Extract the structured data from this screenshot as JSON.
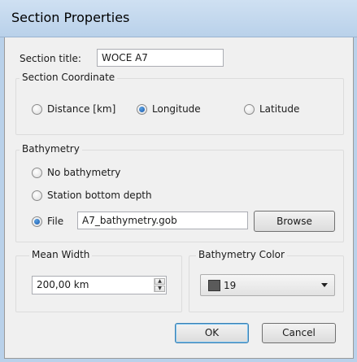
{
  "window": {
    "title": "Section Properties"
  },
  "section_title": {
    "label": "Section title:",
    "value": "WOCE A7"
  },
  "coordinate": {
    "group_label": "Section Coordinate",
    "options": [
      "Distance [km]",
      "Longitude",
      "Latitude"
    ],
    "selected": "Longitude"
  },
  "bathymetry": {
    "group_label": "Bathymetry",
    "options": [
      "No bathymetry",
      "Station bottom depth",
      "File"
    ],
    "selected": "File",
    "file_value": "A7_bathymetry.gob",
    "browse_label": "Browse"
  },
  "mean_width": {
    "group_label": "Mean Width",
    "value": "200,00 km"
  },
  "bathymetry_color": {
    "group_label": "Bathymetry Color",
    "value": "19",
    "swatch_color": "#5a5a5a"
  },
  "buttons": {
    "ok_label": "OK",
    "cancel_label": "Cancel"
  },
  "colors": {
    "accent": "#3c7fb1",
    "titlebar": "#b9d1ea",
    "panel": "#f0f0f0"
  }
}
